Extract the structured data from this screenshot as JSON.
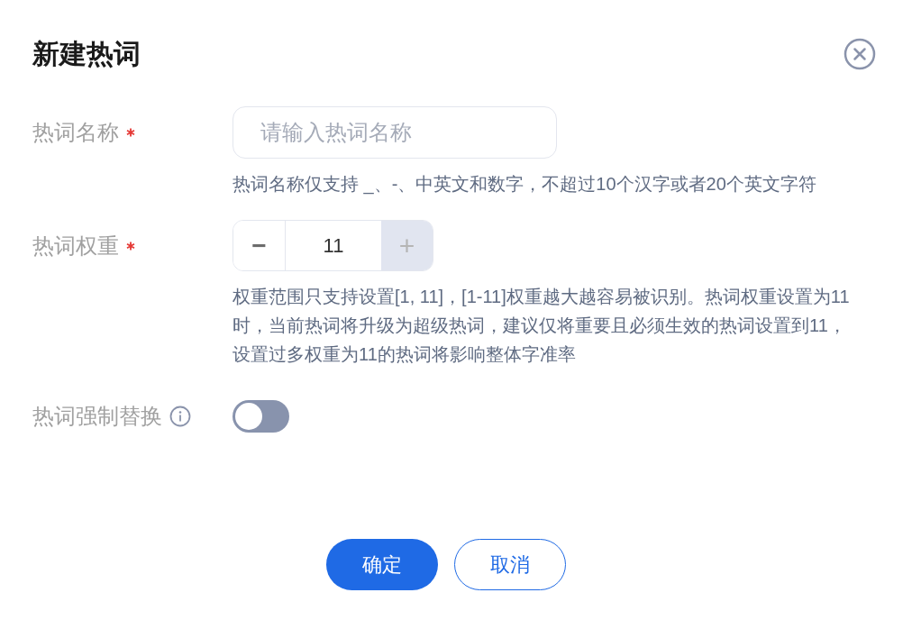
{
  "dialog": {
    "title": "新建热词"
  },
  "fields": [
    {
      "kind": "input",
      "label": "热词名称",
      "required": true,
      "info": false,
      "placeholder": "请输入热词名称",
      "hint": "热词名称仅支持 _、-、中英文和数字，不超过10个汉字或者20个英文字符"
    },
    {
      "kind": "stepper",
      "label": "热词权重",
      "required": true,
      "info": false,
      "minus": "−",
      "value": "11",
      "plus": "+",
      "minus_disabled": false,
      "plus_disabled": true,
      "hint": "权重范围只支持设置[1, 11]，[1-11]权重越大越容易被识别。热词权重设置为11时，当前热词将升级为超级热词，建议仅将重要且必须生效的热词设置到11，设置过多权重为11的热词将影响整体字准率"
    },
    {
      "kind": "switch",
      "label": "热词强制替换",
      "required": false,
      "info": true,
      "on": false
    }
  ],
  "buttons": [
    {
      "kind": "primary",
      "label": "确定"
    },
    {
      "kind": "secondary",
      "label": "取消"
    }
  ]
}
